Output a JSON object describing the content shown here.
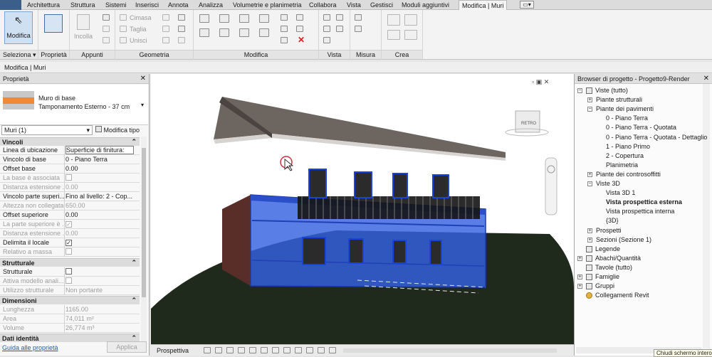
{
  "tabs": [
    "Architettura",
    "Struttura",
    "Sistemi",
    "Inserisci",
    "Annota",
    "Analizza",
    "Volumetrie e planimetria",
    "Collabora",
    "Vista",
    "Gestisci",
    "Moduli aggiuntivi",
    "Modifica | Muri"
  ],
  "ribbon": {
    "modifica_label": "Modifica",
    "seleziona_label": "Seleziona",
    "proprieta_label": "Proprietà",
    "appunti_label": "Appunti",
    "geometria_label": "Geometria",
    "modifica_group_label": "Modifica",
    "vista_label": "Vista",
    "misura_label": "Misura",
    "crea_label": "Crea",
    "incolla_label": "Incolla",
    "cimasa_label": "Cimasa",
    "taglia_label": "Taglia",
    "unisci_label": "Unisci"
  },
  "context_bar": "Modifica | Muri",
  "properties": {
    "title": "Proprietà",
    "type_name_1": "Muro di base",
    "type_name_2": "Tamponamento Esterno - 37 cm",
    "instance_selector": "Muri (1)",
    "edit_type_label": "Modifica tipo",
    "sections": {
      "vincoli": "Vincoli",
      "strutturale": "Strutturale",
      "dimensioni": "Dimensioni",
      "dati_identita": "Dati identità"
    },
    "vincoli_rows": [
      {
        "k": "Linea di ubicazione",
        "v": "Superficie di finitura:"
      },
      {
        "k": "Vincolo di base",
        "v": "0 - Piano Terra"
      },
      {
        "k": "Offset base",
        "v": "0.00"
      },
      {
        "k": "La base è associata",
        "v": ""
      },
      {
        "k": "Distanza estensione ...",
        "v": "0.00"
      },
      {
        "k": "Vincolo parte superi...",
        "v": "Fino al livello: 2 - Cop..."
      },
      {
        "k": "Altezza non collegata",
        "v": "650.00"
      },
      {
        "k": "Offset superiore",
        "v": "0.00"
      },
      {
        "k": "La parte superiore è ...",
        "v": ""
      },
      {
        "k": "Distanza estensione ...",
        "v": "0.00"
      },
      {
        "k": "Delimita il locale",
        "v": ""
      },
      {
        "k": "Relativo a massa",
        "v": ""
      }
    ],
    "strutturale_rows": [
      {
        "k": "Strutturale",
        "v": ""
      },
      {
        "k": "Attiva modello anali...",
        "v": ""
      },
      {
        "k": "Utilizzo strutturale",
        "v": "Non portante"
      }
    ],
    "dimensioni_rows": [
      {
        "k": "Lunghezza",
        "v": "1165.00"
      },
      {
        "k": "Area",
        "v": "74,011 m²"
      },
      {
        "k": "Volume",
        "v": "26,774 m³"
      }
    ],
    "help_link": "Guida alle proprietà",
    "apply_label": "Applica"
  },
  "view_bar": {
    "label": "Prospettiva"
  },
  "viewcube": {
    "label": "RETRO"
  },
  "browser": {
    "title": "Browser di progetto - Progetto9-Render",
    "nodes": [
      "Viste (tutto)",
      "Piante strutturali",
      "Piante dei pavimenti",
      "0 - Piano Terra",
      "0 - Piano Terra - Quotata",
      "0 - Piano Terra - Quotata - Dettaglio",
      "1 - Piano Primo",
      "2 - Copertura",
      "Planimetria",
      "Piante dei controsoffitti",
      "Viste 3D",
      "Vista 3D 1",
      "Vista prospettica esterna",
      "Vista prospettica interna",
      "{3D}",
      "Prospetti",
      "Sezioni (Sezione 1)",
      "Legende",
      "Abachi/Quantità",
      "Tavole (tutto)",
      "Famiglie",
      "Gruppi",
      "Collegamenti Revit"
    ]
  },
  "tooltip": "Chiudi schermo intero",
  "colors": {
    "accent": "#3f6fa6",
    "wall_highlight": "#3561e0",
    "swatch": "#ee8a3a"
  }
}
